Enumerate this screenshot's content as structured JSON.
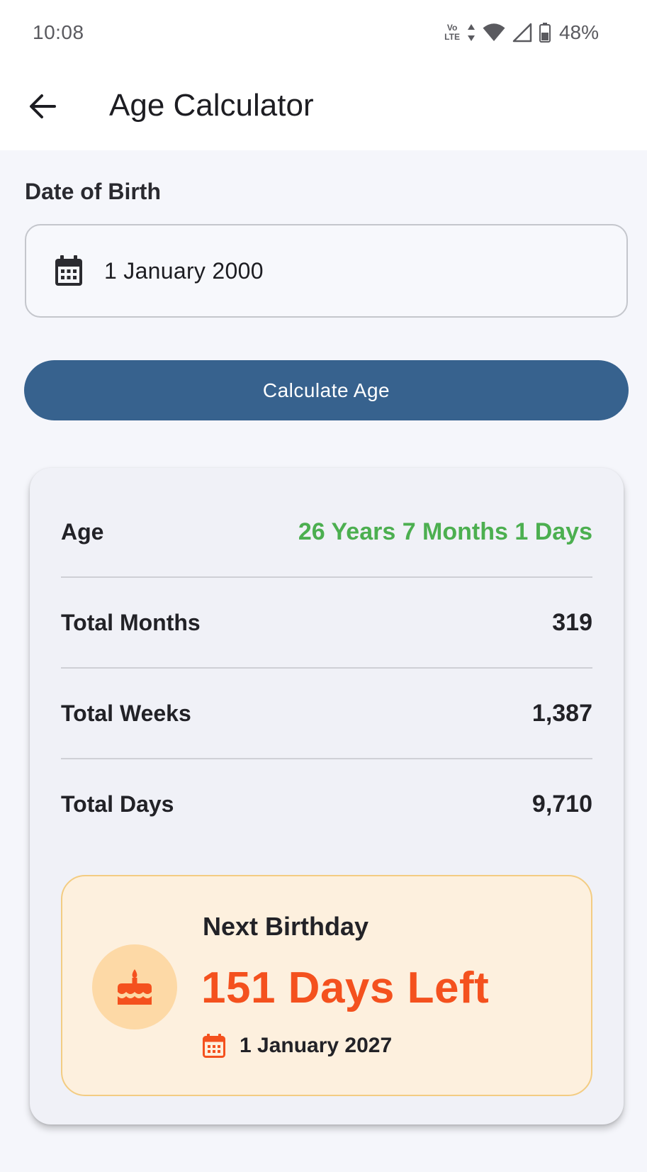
{
  "status_bar": {
    "time": "10:08",
    "volte_top": "Vo",
    "volte_bottom": "LTE",
    "battery": "48%",
    "icons": [
      "volte-icon",
      "data-arrows-icon",
      "wifi-icon",
      "signal-icon",
      "battery-icon"
    ]
  },
  "app_bar": {
    "title": "Age Calculator",
    "back_icon": "arrow-left-icon"
  },
  "form": {
    "dob_label": "Date of Birth",
    "dob_value": "1 January 2000",
    "dob_icon": "calendar-icon",
    "calculate_label": "Calculate Age"
  },
  "results": {
    "rows": [
      {
        "label": "Age",
        "value": "26 Years 7 Months 1 Days"
      },
      {
        "label": "Total Months",
        "value": "319"
      },
      {
        "label": "Total Weeks",
        "value": "1,387"
      },
      {
        "label": "Total Days",
        "value": "9,710"
      }
    ],
    "next_birthday": {
      "title": "Next Birthday",
      "days_left": "151 Days Left",
      "date": "1 January 2027",
      "icon": "cake-icon"
    }
  },
  "colors": {
    "primary_button": "#37628e",
    "age_value": "#4caf50",
    "days_left": "#f4511e",
    "birthday_bg": "#fdf0de",
    "birthday_border": "#f3cc82"
  }
}
